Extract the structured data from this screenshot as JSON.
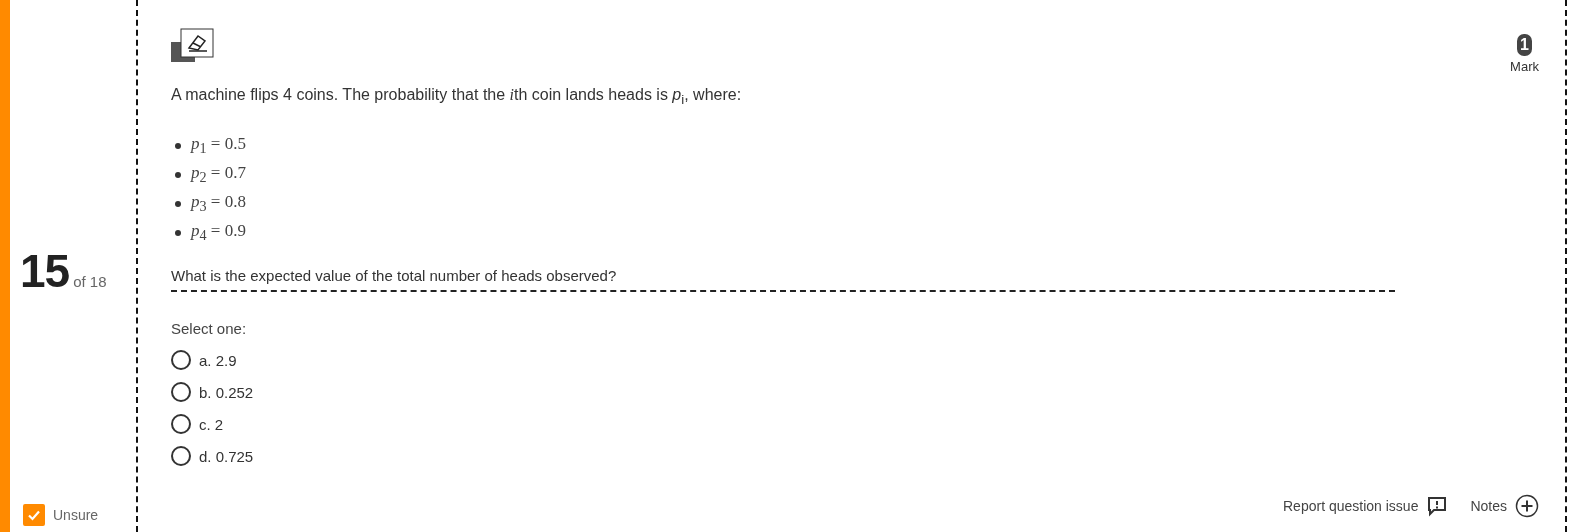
{
  "question_number": {
    "number": "15",
    "of_total": "of 18"
  },
  "unsure": {
    "label": "Unsure",
    "checked": true
  },
  "marks": {
    "value": "1",
    "label": "Mark"
  },
  "question": {
    "intro": [
      {
        "kind": "text",
        "text": "A machine flips 4 coins. The probability that the "
      },
      {
        "kind": "variable",
        "text": "i"
      },
      {
        "kind": "text",
        "text": "th coin lands heads is *p*$_{i}$, where:"
      }
    ],
    "items": [
      "*p*$_{1}$ = 0.5",
      "*p*$_{2}$ = 0.7",
      "*p*$_{3}$ = 0.8",
      "*p*$_{4}$ = 0.9"
    ],
    "prompt": "What is the expected value of the total number of heads observed?"
  },
  "answer": {
    "instruction": "Select one:",
    "options": [
      {
        "label": "a. 2.9",
        "selected": false
      },
      {
        "label": "b. 0.252",
        "selected": false
      },
      {
        "label": "c. 2",
        "selected": false
      },
      {
        "label": "d. 0.725",
        "selected": false
      }
    ]
  },
  "footer": {
    "report": "Report question issue",
    "notes": "Notes"
  }
}
